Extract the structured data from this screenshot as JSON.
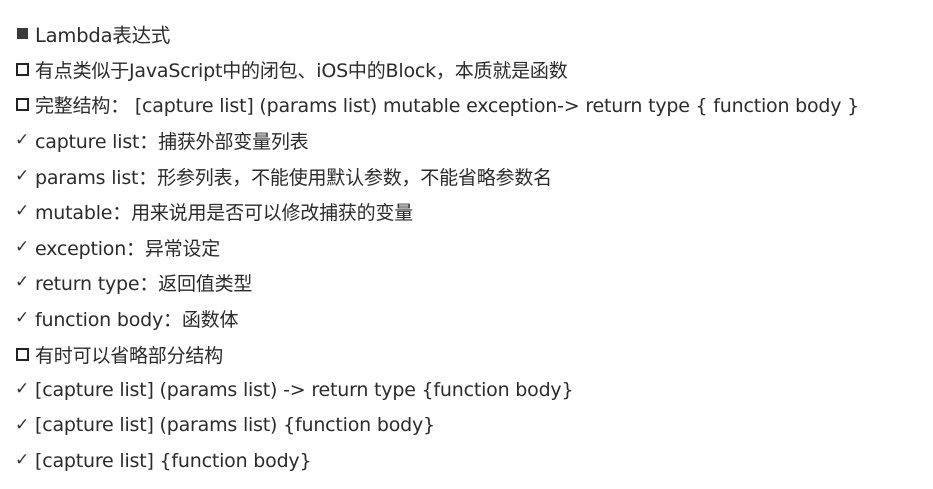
{
  "lines": [
    {
      "marker": "filled-square",
      "text": "Lambda表达式"
    },
    {
      "marker": "hollow-square",
      "text": "有点类似于JavaScript中的闭包、iOS中的Block，本质就是函数"
    },
    {
      "marker": "hollow-square",
      "text": "完整结构： [capture list] (params list) mutable exception-> return type { function body }"
    },
    {
      "marker": "check",
      "text": "capture list：捕获外部变量列表"
    },
    {
      "marker": "check",
      "text": "params list：形参列表，不能使用默认参数，不能省略参数名"
    },
    {
      "marker": "check",
      "text": "mutable：用来说用是否可以修改捕获的变量"
    },
    {
      "marker": "check",
      "text": "exception：异常设定"
    },
    {
      "marker": "check",
      "text": "return type：返回值类型"
    },
    {
      "marker": "check",
      "text": "function body：函数体"
    },
    {
      "marker": "hollow-square",
      "text": "有时可以省略部分结构"
    },
    {
      "marker": "check",
      "text": "[capture list] (params list) -> return type {function body}"
    },
    {
      "marker": "check",
      "text": "[capture list] (params list) {function body}"
    },
    {
      "marker": "check",
      "text": "[capture list] {function body}"
    }
  ],
  "check_glyph": "✓"
}
